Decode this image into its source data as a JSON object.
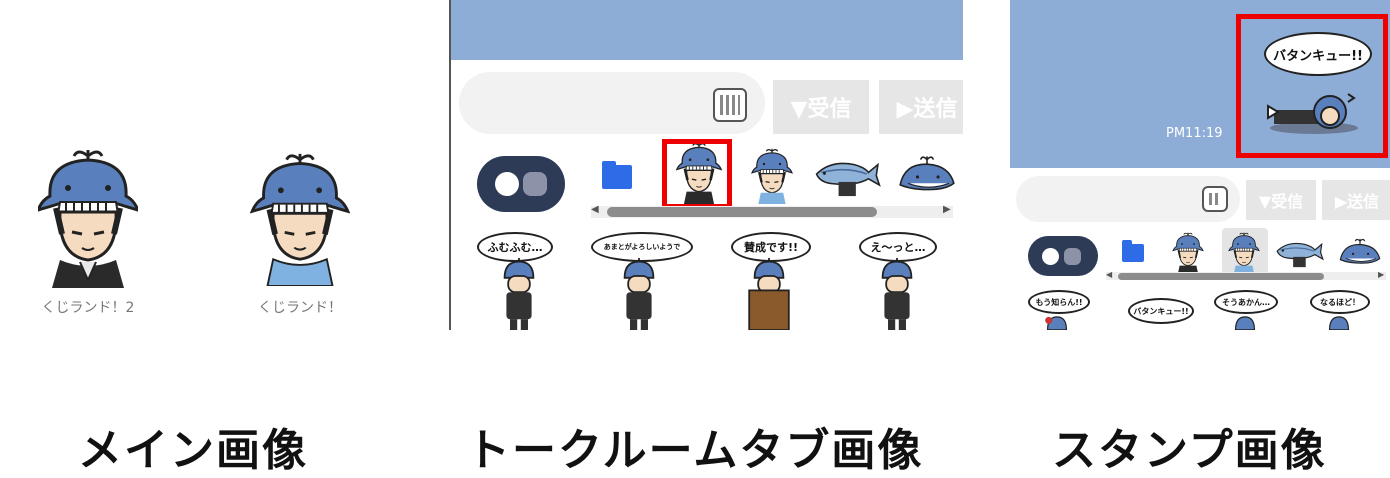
{
  "captions": {
    "main": "メイン画像",
    "talkroom": "トークルームタブ画像",
    "stamp": "スタンプ画像"
  },
  "main_panel": {
    "labels": [
      "くじランド！2",
      "くじランド！"
    ]
  },
  "talk_panel": {
    "receive_label": "▼受信",
    "send_label": "▶送信",
    "bubbles": [
      "ふむふむ…",
      "あまとがよろしいようで",
      "賛成です!!",
      "え〜っと…"
    ]
  },
  "stamp_panel": {
    "message_bubble": "バタンキュー!!",
    "time": "PM11:19",
    "receive_label": "▼受信",
    "send_label": "▶送信",
    "bubbles": [
      "もう知らん!!",
      "バタンキュー!!",
      "そうあかん…",
      "なるほど！"
    ]
  },
  "colors": {
    "chat_bg": "#8eadd6",
    "highlight": "#e00000",
    "toggle": "#2d3b57"
  }
}
